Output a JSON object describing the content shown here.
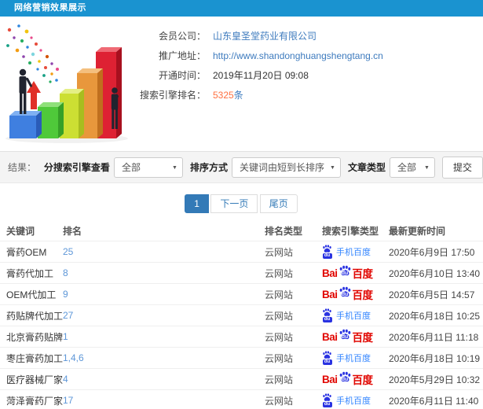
{
  "header": {
    "title": "网络营销效果展示"
  },
  "info": {
    "rows": [
      {
        "label": "会员公司：",
        "value": "山东皇圣堂药业有限公司"
      },
      {
        "label": "推广地址：",
        "value": "http://www.shandonghuangshengtang.cn"
      },
      {
        "label": "开通时间：",
        "value": "2019年11月20日 09:08"
      },
      {
        "label": "搜索引擎排名：",
        "value": "5325",
        "suffix": "条"
      }
    ]
  },
  "filters": {
    "result_label": "结果：",
    "engine_filter_label": "分搜索引擎查看",
    "engine_filter_value": "全部",
    "sort_label": "排序方式",
    "sort_value": "关键词由短到长排序",
    "article_type_label": "文章类型",
    "article_type_value": "全部",
    "submit_label": "提交",
    "dropdown_arrow": "▼"
  },
  "pagination": {
    "current": "1",
    "next": "下一页",
    "last": "尾页"
  },
  "table": {
    "headers": [
      "关键词",
      "排名",
      "排名类型",
      "搜索引擎类型",
      "最新更新时间"
    ],
    "rows": [
      {
        "keyword": "膏药OEM",
        "rank": "25",
        "rank_type": "云网站",
        "engine": "mobile",
        "time": "2020年6月9日 17:50"
      },
      {
        "keyword": "膏药代加工",
        "rank": "8",
        "rank_type": "云网站",
        "engine": "baidu",
        "time": "2020年6月10日 13:40"
      },
      {
        "keyword": "OEM代加工",
        "rank": "9",
        "rank_type": "云网站",
        "engine": "baidu",
        "time": "2020年6月5日 14:57"
      },
      {
        "keyword": "药贴牌代加工",
        "rank": "27",
        "rank_type": "云网站",
        "engine": "mobile",
        "time": "2020年6月18日 10:25"
      },
      {
        "keyword": "北京膏药贴牌",
        "rank": "1",
        "rank_type": "云网站",
        "engine": "baidu",
        "time": "2020年6月11日 11:18"
      },
      {
        "keyword": "枣庄膏药加工",
        "rank": "1,4,6",
        "rank_type": "云网站",
        "engine": "mobile",
        "time": "2020年6月18日 10:19"
      },
      {
        "keyword": "医疗器械厂家",
        "rank": "4",
        "rank_type": "云网站",
        "engine": "baidu",
        "time": "2020年5月29日 10:32"
      },
      {
        "keyword": "菏泽膏药厂家",
        "rank": "17",
        "rank_type": "云网站",
        "engine": "mobile",
        "time": "2020年6月11日 11:40"
      }
    ]
  },
  "engines": {
    "mobile": {
      "label": "手机百度",
      "du": "du"
    },
    "baidu": {
      "bai": "Bai",
      "du": "du",
      "name": "百度"
    }
  },
  "colors": {
    "header_blue": "#1a93d0",
    "link_blue": "#3e7bbe",
    "rank_blue": "#5e97d8",
    "highlight_orange": "#ff7040",
    "pagination_blue": "#337ab7",
    "baidu_red": "#e10601",
    "baidu_paw_blue": "#2932e1",
    "mobile_baidu_blue": "#3385ff"
  }
}
